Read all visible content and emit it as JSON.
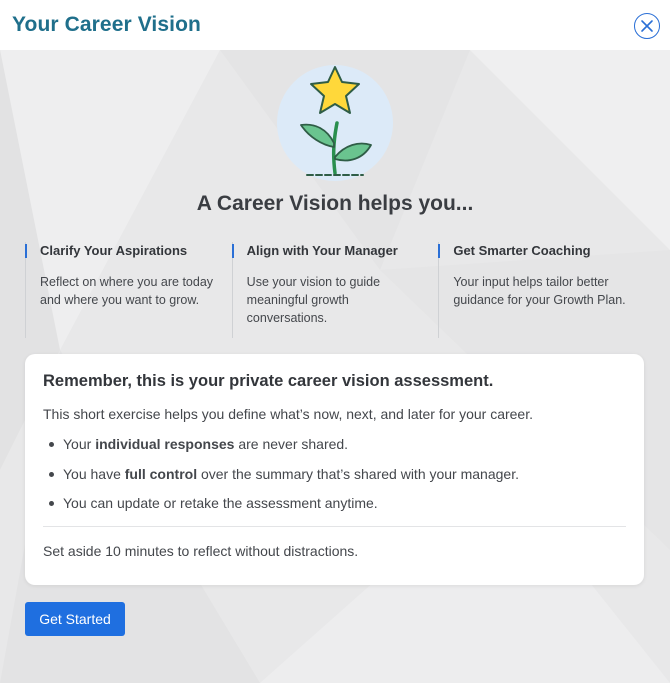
{
  "header": {
    "title": "Your Career Vision",
    "close_icon": "close-icon",
    "title_color": "#1f6f8b"
  },
  "hero": {
    "icon": "star-sprout-icon",
    "headline": "A Career Vision helps you..."
  },
  "benefits": [
    {
      "title": "Clarify Your Aspirations",
      "text": "Reflect on where you are today and where you want to grow."
    },
    {
      "title": "Align with Your Manager",
      "text": "Use your vision to guide meaningful growth conversations."
    },
    {
      "title": "Get Smarter Coaching",
      "text": "Your input helps tailor better guidance for your Growth Plan."
    }
  ],
  "card": {
    "heading": "Remember, this is your private career vision assessment.",
    "intro": "This short exercise helps you define what’s now, next, and later for your career.",
    "bullets": [
      {
        "before": "Your ",
        "bold": "individual responses",
        "after": " are never shared."
      },
      {
        "before": "You have ",
        "bold": "full control",
        "after": " over the summary that’s shared with your manager."
      },
      {
        "before": "You can update or retake the assessment anytime.",
        "bold": "",
        "after": ""
      }
    ],
    "footnote": "Set aside 10 minutes to reflect without distractions."
  },
  "cta": {
    "label": "Get Started",
    "color": "#1f6fe0"
  }
}
